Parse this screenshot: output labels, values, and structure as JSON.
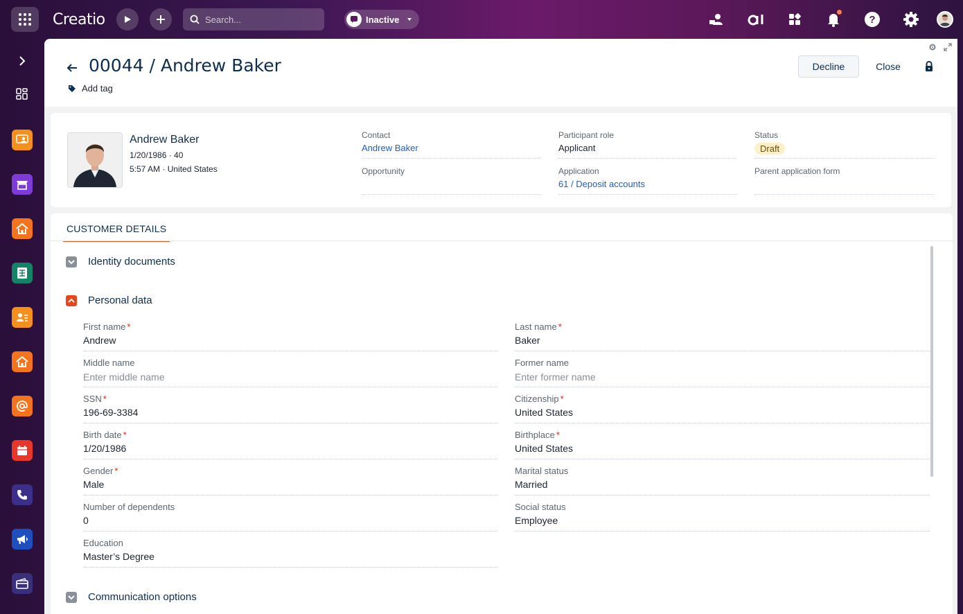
{
  "topbar": {
    "logo": "Creatio",
    "search_placeholder": "Search...",
    "status_label": "Inactive"
  },
  "header": {
    "title": "00044 / Andrew Baker",
    "add_tag": "Add tag",
    "decline_label": "Decline",
    "close_label": "Close"
  },
  "profile": {
    "name": "Andrew Baker",
    "dob_age": "1/20/1986 · 40",
    "time_country": "5:57 AM · United States",
    "contact_label": "Contact",
    "contact_value": "Andrew Baker",
    "opportunity_label": "Opportunity",
    "opportunity_value": "",
    "participant_role_label": "Participant role",
    "participant_role_value": "Applicant",
    "application_label": "Application",
    "application_value": "61 / Deposit accounts",
    "status_label": "Status",
    "status_value": "Draft",
    "parent_form_label": "Parent application form",
    "parent_form_value": ""
  },
  "details": {
    "tab_label": "CUSTOMER DETAILS",
    "group_identity": "Identity documents",
    "group_personal": "Personal data",
    "group_communication": "Communication options",
    "fields": {
      "first_name": {
        "label": "First name",
        "value": "Andrew"
      },
      "last_name": {
        "label": "Last name",
        "value": "Baker"
      },
      "middle_name": {
        "label": "Middle name",
        "placeholder": "Enter middle name"
      },
      "former_name": {
        "label": "Former name",
        "placeholder": "Enter former name"
      },
      "ssn": {
        "label": "SSN",
        "value": "196-69-3384"
      },
      "citizenship": {
        "label": "Citizenship",
        "value": "United States"
      },
      "birth_date": {
        "label": "Birth date",
        "value": "1/20/1986"
      },
      "birthplace": {
        "label": "Birthplace",
        "value": "United States"
      },
      "gender": {
        "label": "Gender",
        "value": "Male"
      },
      "marital_status": {
        "label": "Marital status",
        "value": "Married"
      },
      "dependents": {
        "label": "Number of dependents",
        "value": "0"
      },
      "social_status": {
        "label": "Social status",
        "value": "Employee"
      },
      "education": {
        "label": "Education",
        "value": "Master’s Degree"
      }
    },
    "required_mark": "*"
  },
  "colors": {
    "accent": "#e8571f",
    "link": "#1f5fc4",
    "title": "#0d2e4e",
    "draft_badge_bg": "#fdf0c8"
  },
  "icons": {
    "rail_apps": [
      "customer-icon",
      "marketplace-icon",
      "home-icon",
      "spreadsheet-icon",
      "contact-card-icon",
      "home-icon",
      "email-at-icon",
      "calendar-icon",
      "phone-icon",
      "megaphone-icon",
      "card-icon"
    ]
  }
}
